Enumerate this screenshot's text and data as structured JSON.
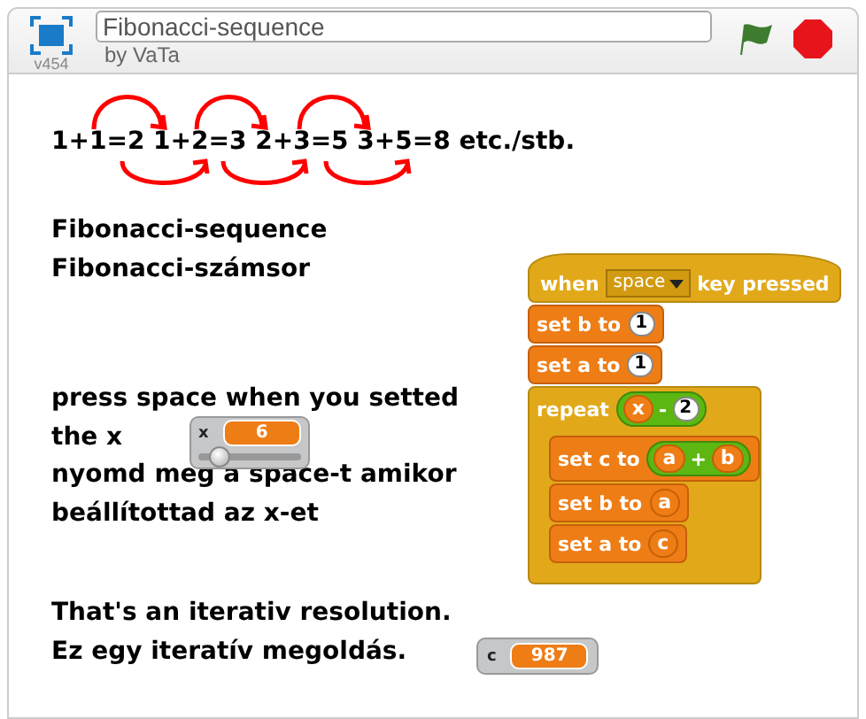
{
  "header": {
    "version": "v454",
    "title": "Fibonacci-sequence",
    "author": "by VaTa"
  },
  "stage": {
    "equation": "1+1=2 1+2=3 2+3=5 3+5=8 etc./stb.",
    "paragraphs": [
      [
        "Fibonacci-sequence",
        "Fibonacci-számsor"
      ],
      [
        "press space when you setted",
        "the x",
        "nyomd meg a space-t amikor",
        "beállítottad az x-et"
      ],
      [
        "That's an iterativ resolution.",
        "Ez egy iteratív megoldás."
      ]
    ],
    "monitors": [
      {
        "kind": "slider",
        "label": "x",
        "value": "6",
        "level": 0.2
      },
      {
        "kind": "readout",
        "label": "c",
        "value": "987"
      }
    ],
    "script": [
      {
        "kind": "hat",
        "parts": [
          {
            "kind": "text",
            "text": "when"
          },
          {
            "kind": "dropdown",
            "text": "space"
          },
          {
            "kind": "text",
            "text": "key pressed"
          }
        ]
      },
      {
        "kind": "command",
        "parts": [
          {
            "kind": "text",
            "text": "set b to"
          },
          {
            "kind": "number",
            "text": "1"
          }
        ]
      },
      {
        "kind": "command",
        "parts": [
          {
            "kind": "text",
            "text": "set a to"
          },
          {
            "kind": "number",
            "text": "1"
          }
        ]
      },
      {
        "kind": "c-block",
        "parts": [
          {
            "kind": "text",
            "text": "repeat"
          },
          {
            "kind": "operator",
            "parts": [
              {
                "kind": "reporter",
                "text": "x"
              },
              {
                "kind": "text",
                "text": "-"
              },
              {
                "kind": "number",
                "text": "2"
              }
            ]
          }
        ],
        "children": [
          {
            "kind": "command",
            "parts": [
              {
                "kind": "text",
                "text": "set c to"
              },
              {
                "kind": "operator",
                "parts": [
                  {
                    "kind": "reporter",
                    "text": "a"
                  },
                  {
                    "kind": "text",
                    "text": "+"
                  },
                  {
                    "kind": "reporter",
                    "text": "b"
                  }
                ]
              }
            ]
          },
          {
            "kind": "command",
            "parts": [
              {
                "kind": "text",
                "text": "set b to"
              },
              {
                "kind": "reporter",
                "text": "a"
              }
            ]
          },
          {
            "kind": "command",
            "parts": [
              {
                "kind": "text",
                "text": "set a to"
              },
              {
                "kind": "reporter",
                "text": "c"
              }
            ]
          }
        ]
      }
    ]
  }
}
